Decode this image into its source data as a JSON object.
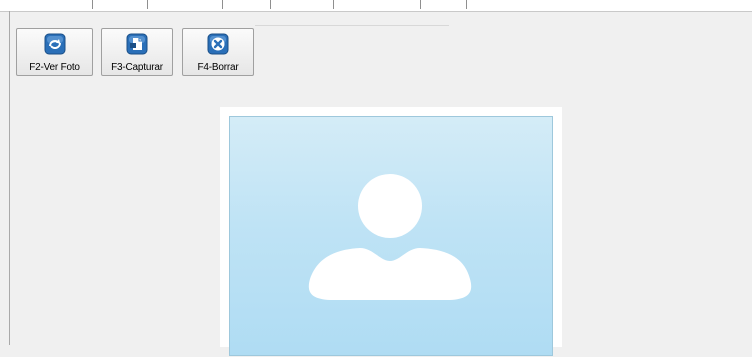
{
  "toolbar": {
    "buttons": [
      {
        "label": "F2-Ver Foto",
        "icon": "refresh-camera-icon"
      },
      {
        "label": "F3-Capturar",
        "icon": "capture-document-icon"
      },
      {
        "label": "F4-Borrar",
        "icon": "delete-x-icon"
      }
    ]
  },
  "photo": {
    "placeholder_icon": "user-silhouette-icon"
  },
  "colors": {
    "window_bg": "#f0f0f0",
    "photo_bg_top": "#d4ecf7",
    "photo_bg_bottom": "#afdcf3",
    "button_icon_blue": "#2a6fb8"
  }
}
